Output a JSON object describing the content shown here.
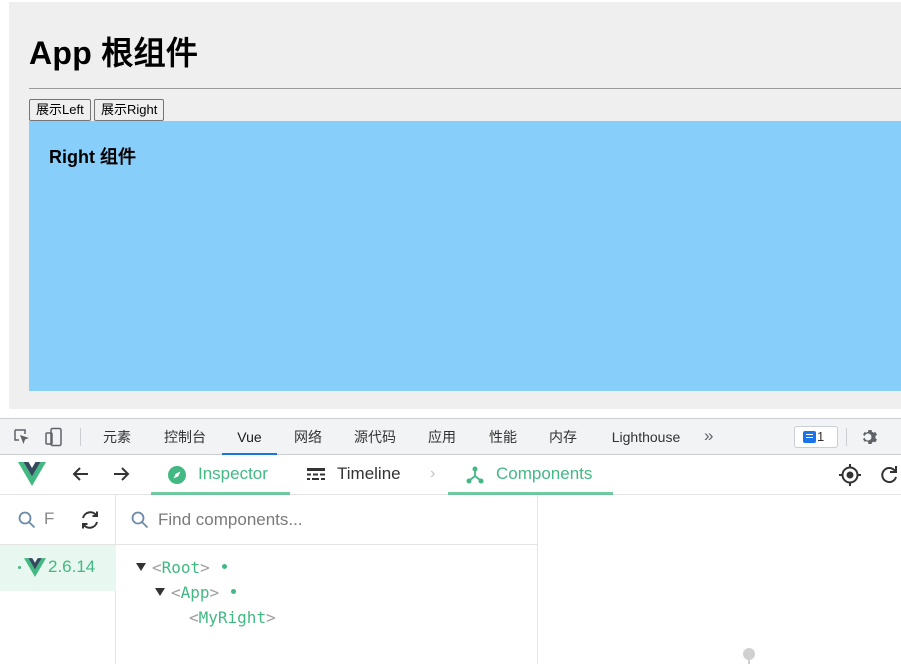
{
  "page": {
    "app_title": "App 根组件",
    "buttons": {
      "show_left": "展示Left",
      "show_right": "展示Right"
    },
    "right_component_title": "Right 组件",
    "colors": {
      "right_box_bg": "#87cefa",
      "app_bg": "#efefef"
    }
  },
  "devtools": {
    "tabs": [
      "元素",
      "控制台",
      "Vue",
      "网络",
      "源代码",
      "应用",
      "性能",
      "内存",
      "Lighthouse"
    ],
    "active_tab": "Vue",
    "more_icon": "double-chevron-right-icon",
    "issues_count": "1",
    "settings_icon": "gear-icon"
  },
  "vue": {
    "tabs": {
      "inspector": "Inspector",
      "timeline": "Timeline",
      "components": "Components"
    },
    "accent": "#42b883",
    "app_version": "2.6.14",
    "search_placeholder": "Find components...",
    "tree": {
      "root": "Root",
      "app": "App",
      "my_right": "MyRight"
    }
  }
}
